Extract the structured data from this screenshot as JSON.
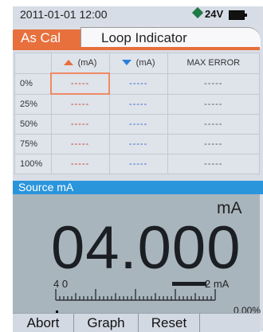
{
  "status": {
    "datetime": "2011-01-01  12:00",
    "voltage": "24V"
  },
  "tabs": {
    "active": "As Cal",
    "inactive": "Loop Indicator"
  },
  "table": {
    "headers": [
      "(mA)",
      "(mA)",
      "MAX ERROR"
    ],
    "rows": [
      {
        "label": "0%",
        "up": "-----",
        "down": "-----",
        "err": "-----"
      },
      {
        "label": "25%",
        "up": "-----",
        "down": "-----",
        "err": "-----"
      },
      {
        "label": "50%",
        "up": "-----",
        "down": "-----",
        "err": "-----"
      },
      {
        "label": "75%",
        "up": "-----",
        "down": "-----",
        "err": "-----"
      },
      {
        "label": "100%",
        "up": "-----",
        "down": "-----",
        "err": "-----"
      }
    ]
  },
  "source": {
    "label": "Source mA"
  },
  "display": {
    "unit": "mA",
    "reading_parts": [
      "04.0",
      "0",
      "0"
    ],
    "scale_left": "4 0",
    "scale_right": "2  mA",
    "percent": "0.00%"
  },
  "softkeys": [
    "Abort",
    "Graph",
    "Reset"
  ],
  "colors": {
    "accent": "#e7703d",
    "blue": "#2b95dc",
    "lcd": "#a9b5bd"
  },
  "icons": {
    "up": "triangle-up-icon",
    "down": "triangle-down-icon",
    "battery": "battery-icon",
    "power": "power-diamond-icon"
  }
}
